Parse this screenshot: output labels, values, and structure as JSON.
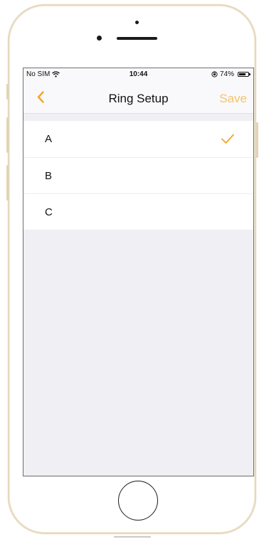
{
  "statusbar": {
    "carrier": "No SIM",
    "wifi_icon": "wifi-icon",
    "time": "10:44",
    "lock_icon": "rotation-lock-icon",
    "battery_percent": "74%",
    "battery_level": 0.74
  },
  "navbar": {
    "back_icon": "chevron-left-icon",
    "title": "Ring Setup",
    "save_label": "Save"
  },
  "options": [
    {
      "label": "A",
      "selected": true
    },
    {
      "label": "B",
      "selected": false
    },
    {
      "label": "C",
      "selected": false
    }
  ],
  "colors": {
    "accent": "#f5a623",
    "save_disabled": "#f5c26b",
    "background": "#efeff4"
  }
}
